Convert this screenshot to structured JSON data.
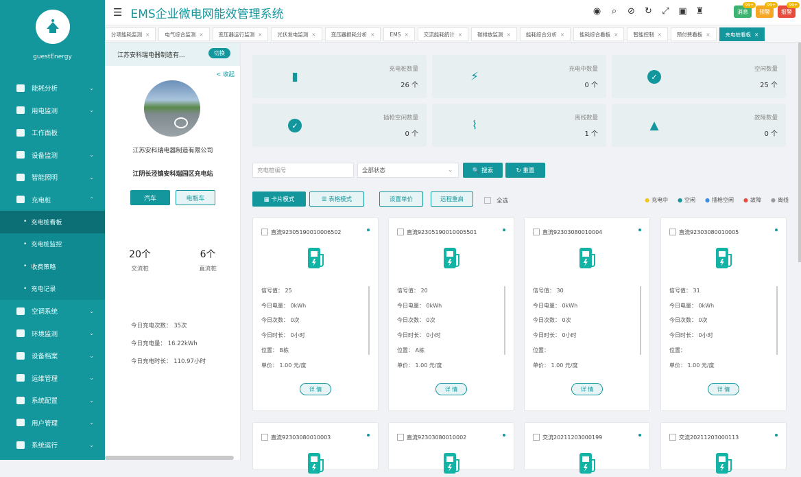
{
  "app": {
    "title": "EMS企业微电网能效管理系统",
    "user": "guestEnergy"
  },
  "header": {
    "icons": [
      "user-circle-icon",
      "search-icon",
      "mute-icon",
      "refresh-icon",
      "fullscreen-icon",
      "terminal-icon",
      "shirt-icon"
    ],
    "buttons": [
      {
        "label": "消息",
        "badge": "99+",
        "color": "#3cb371"
      },
      {
        "label": "预警",
        "badge": "99+",
        "color": "#f5a623"
      },
      {
        "label": "报警",
        "badge": "99+",
        "color": "#e74c3c"
      }
    ]
  },
  "tabs": [
    "分项能耗监测",
    "电气综合监测",
    "变压器运行监测",
    "光伏发电监测",
    "变压器损耗分析",
    "EMS",
    "交流能耗统计",
    "碳排放监测",
    "能耗综合分析",
    "能耗综合看板",
    "智能控制",
    "预付费看板",
    "充电桩看板"
  ],
  "active_tab": "充电桩看板",
  "sidebar": {
    "menu": [
      {
        "label": "能耗分析",
        "icon": "bar-chart-icon",
        "arrow": "⌄"
      },
      {
        "label": "用电监测",
        "icon": "plug-icon",
        "arrow": "⌄"
      },
      {
        "label": "工作面板",
        "icon": "monitor-icon",
        "arrow": ""
      },
      {
        "label": "设备监测",
        "icon": "device-icon",
        "arrow": "⌄"
      },
      {
        "label": "智能照明",
        "icon": "bulb-icon",
        "arrow": "⌄"
      },
      {
        "label": "充电桩",
        "icon": "charger-icon",
        "arrow": "⌃"
      }
    ],
    "submenu": [
      {
        "label": "充电桩看板",
        "active": true
      },
      {
        "label": "充电桩监控",
        "active": false
      },
      {
        "label": "收费策略",
        "active": false
      },
      {
        "label": "充电记录",
        "active": false
      }
    ],
    "menu2": [
      {
        "label": "空调系统",
        "icon": "ac-icon",
        "arrow": "⌄"
      },
      {
        "label": "环境监测",
        "icon": "env-icon",
        "arrow": "⌄"
      },
      {
        "label": "设备档案",
        "icon": "archive-icon",
        "arrow": "⌄"
      },
      {
        "label": "运维管理",
        "icon": "wrench-icon",
        "arrow": "⌄"
      },
      {
        "label": "系统配置",
        "icon": "lock-icon",
        "arrow": "⌄"
      },
      {
        "label": "用户管理",
        "icon": "edit-icon",
        "arrow": "⌄"
      },
      {
        "label": "系统运行",
        "icon": "run-icon",
        "arrow": "⌄"
      }
    ]
  },
  "left": {
    "company_short": "江苏安科瑞电器制造有...",
    "switch": "切换",
    "collapse": "< 收起",
    "company_full": "江苏安科瑞电器制造有限公司",
    "address": "江阴长泾镇安科瑞园区充电站",
    "seg_car": "汽车",
    "seg_ebike": "电瓶车",
    "ac_count": "20个",
    "ac_label": "交流桩",
    "dc_count": "6个",
    "dc_label": "直流桩",
    "today_times": "今日充电次数：  35次",
    "today_energy": "今日充电量：  16.22kWh",
    "today_duration": "今日充电时长：  110.97小时"
  },
  "kpis": [
    {
      "label": "充电桩数量",
      "value": "26 个",
      "icon": "charger-icon"
    },
    {
      "label": "充电中数量",
      "value": "0 个",
      "icon": "lightning-icon"
    },
    {
      "label": "空闲数量",
      "value": "25 个",
      "icon": "check-circle-icon"
    },
    {
      "label": "插枪空闲数量",
      "value": "0 个",
      "icon": "check-circle-icon"
    },
    {
      "label": "离线数量",
      "value": "1 个",
      "icon": "unplug-icon"
    },
    {
      "label": "故障数量",
      "value": "0 个",
      "icon": "warning-icon"
    }
  ],
  "filters": {
    "search_placeholder": "充电桩编号",
    "status_select": "全部状态",
    "search_btn": "🔍 搜索",
    "reset_btn": "↻ 重置",
    "card_mode": "▦ 卡片模式",
    "list_mode": "☰ 表格模式",
    "set_price": "设置单价",
    "remote_restart": "远程重启",
    "select_all": "全选"
  },
  "legend": [
    {
      "label": "充电中",
      "color": "#f5c518"
    },
    {
      "label": "空闲",
      "color": "#13979d"
    },
    {
      "label": "插枪空闲",
      "color": "#3a8ee6"
    },
    {
      "label": "故障",
      "color": "#e74c3c"
    },
    {
      "label": "离线",
      "color": "#999999"
    }
  ],
  "cards": [
    {
      "id": "直流92305190010006502",
      "signal": "信号值：  25",
      "energy": "今日电量：  0kWh",
      "times": "今日次数：  0次",
      "duration": "今日时长：  0小时",
      "location": "位置：  B栋",
      "price": "单价：  1.00 元/度",
      "detail": "详 情"
    },
    {
      "id": "直流92305190010005501",
      "signal": "信号值：  20",
      "energy": "今日电量：  0kWh",
      "times": "今日次数：  0次",
      "duration": "今日时长：  0小时",
      "location": "位置：  A栋",
      "price": "单价：  1.00 元/度",
      "detail": "详 情"
    },
    {
      "id": "直流92303080010004",
      "signal": "信号值：  30",
      "energy": "今日电量：  0kWh",
      "times": "今日次数：  0次",
      "duration": "今日时长：  0小时",
      "location": "位置：",
      "price": "单价：  1.00 元/度",
      "detail": "详 情"
    },
    {
      "id": "直流92303080010005",
      "signal": "信号值：  31",
      "energy": "今日电量：  0kWh",
      "times": "今日次数：  0次",
      "duration": "今日时长：  0小时",
      "location": "位置：",
      "price": "单价：  1.00 元/度",
      "detail": "详 情"
    }
  ],
  "cards2": [
    "直流92303080010003",
    "直流92303080010002",
    "交流20211203000199",
    "交流20211203000113"
  ]
}
